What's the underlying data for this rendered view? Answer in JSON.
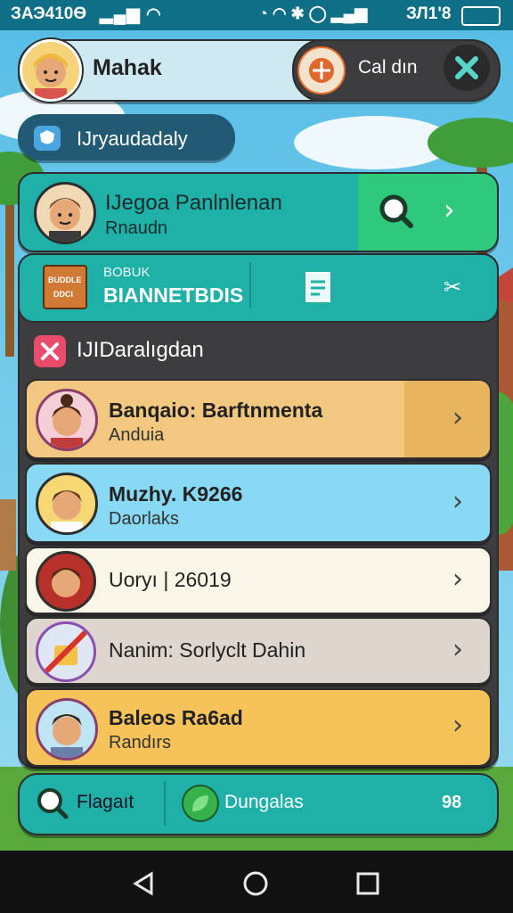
{
  "status_bar": {
    "left_text": "ЗАЭ410Ѳ",
    "right_text": "ЗЛ1'8"
  },
  "header": {
    "user_name": "Mahak",
    "action_label": "Cal dın"
  },
  "badge": {
    "label": "IJryaudadaly"
  },
  "featured": {
    "name": "IJegoa Panlnlenan",
    "subtitle": "Rnaudn"
  },
  "panel": {
    "shop_icon_text_1": "BUDDLE",
    "shop_icon_text_2": "DDCI",
    "small_label": "BOBUK",
    "big_label": "BIANNETBDIS"
  },
  "section": {
    "title": "IJIDaralıgdan"
  },
  "list": [
    {
      "title": "Banqaio: Barftnmenta",
      "subtitle": "Anduia",
      "color": "#f2c880"
    },
    {
      "title": "Muzhy. K9266",
      "subtitle": "Daorlaks",
      "color": "#88d9f3"
    },
    {
      "title": "Uoryı | 26019",
      "subtitle": "",
      "color": "#fbf7e8"
    },
    {
      "title": "Nanim: Sorlyclt Dahin",
      "subtitle": "",
      "color": "#ddd5ce"
    },
    {
      "title": "Baleos Ra6ad",
      "subtitle": "Randırs",
      "color": "#f6c25a"
    }
  ],
  "bottom": {
    "search_label": "Flagaıt",
    "tab_label": "Dungalas",
    "count": "98"
  },
  "colors": {
    "teal": "#1fb0a8",
    "green": "#2ec97a",
    "dark_panel": "#3d3d40",
    "status_bar": "#0e6f86"
  }
}
